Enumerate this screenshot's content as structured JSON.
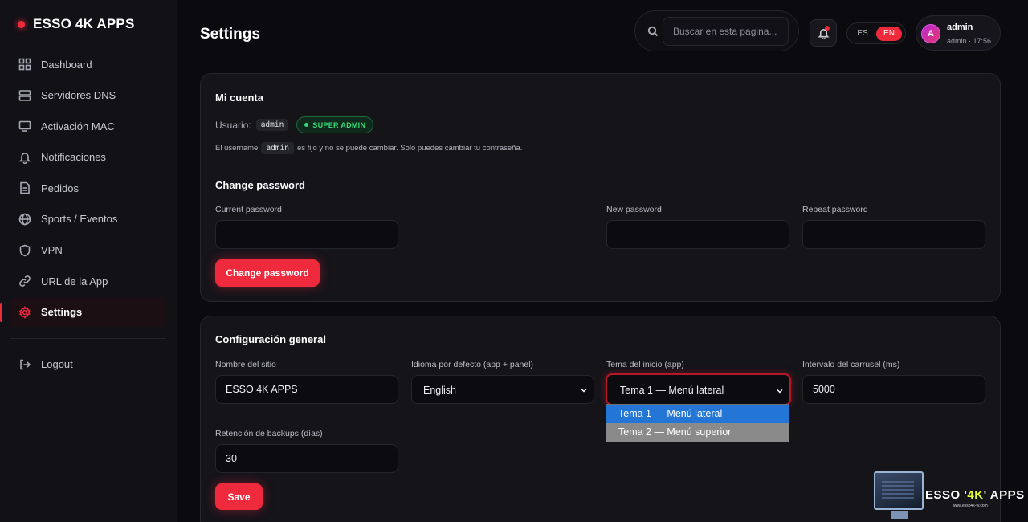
{
  "brand": {
    "title": "ESSO 4K APPS",
    "accent": "#ef2a3c"
  },
  "sidebar": {
    "items": [
      {
        "label": "Dashboard",
        "icon": "dashboard-icon"
      },
      {
        "label": "Servidores DNS",
        "icon": "server-icon"
      },
      {
        "label": "Activación MAC",
        "icon": "monitor-icon"
      },
      {
        "label": "Notificaciones",
        "icon": "bell-icon"
      },
      {
        "label": "Pedidos",
        "icon": "document-icon"
      },
      {
        "label": "Sports / Eventos",
        "icon": "globe-icon"
      },
      {
        "label": "VPN",
        "icon": "shield-icon"
      },
      {
        "label": "URL de la App",
        "icon": "link-icon"
      },
      {
        "label": "Settings",
        "icon": "gear-icon",
        "active": true
      }
    ],
    "logout_label": "Logout"
  },
  "header": {
    "title": "Settings",
    "search_placeholder": "Buscar en esta pagina...",
    "lang_es": "ES",
    "lang_en": "EN",
    "user_initial": "A",
    "user_name": "admin",
    "user_meta": "admin · 17:56"
  },
  "account": {
    "title": "Mi cuenta",
    "usuario_label": "Usuario:",
    "username": "admin",
    "role_badge": "SUPER ADMIN",
    "note_prefix": "El username",
    "note_username": "admin",
    "note_suffix": "es fijo y no se puede cambiar. Solo puedes cambiar tu contraseña.",
    "password_title": "Change password",
    "current_password_label": "Current password",
    "new_password_label": "New password",
    "repeat_password_label": "Repeat password",
    "current_password_value": "",
    "new_password_value": "",
    "repeat_password_value": "",
    "change_button": "Change password"
  },
  "general": {
    "title": "Configuración general",
    "site_name_label": "Nombre del sitio",
    "site_name_value": "ESSO 4K APPS",
    "language_label": "Idioma por defecto (app + panel)",
    "language_value": "English",
    "theme_label": "Tema del inicio (app)",
    "theme_value": "Tema 1 — Menú lateral",
    "theme_options": [
      "Tema 1 — Menú lateral",
      "Tema 2 — Menú superior"
    ],
    "carousel_label": "Intervalo del carrusel (ms)",
    "carousel_value": "5000",
    "backup_label": "Retención de backups (días)",
    "backup_value": "30",
    "save_button": "Save"
  },
  "promo": {
    "text_prefix": "ESSO '",
    "text_highlight": "4K",
    "text_suffix": "' APPS",
    "url": "www.esso4k-tv.com"
  }
}
